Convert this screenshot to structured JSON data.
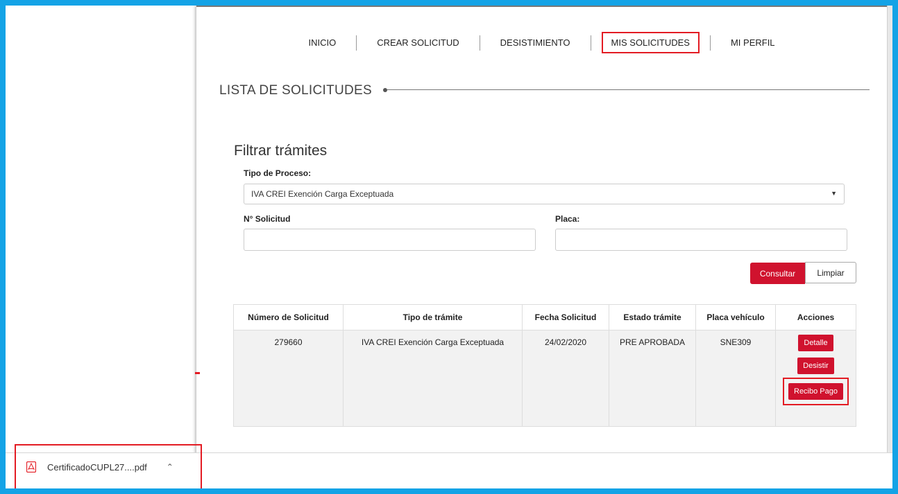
{
  "nav": {
    "items": [
      {
        "label": "INICIO"
      },
      {
        "label": "CREAR SOLICITUD"
      },
      {
        "label": "DESISTIMIENTO"
      },
      {
        "label": "MIS SOLICITUDES"
      },
      {
        "label": "MI PERFIL"
      }
    ]
  },
  "section": {
    "title": "LISTA DE SOLICITUDES"
  },
  "filter": {
    "title": "Filtrar trámites",
    "tipo_label": "Tipo de Proceso:",
    "tipo_value": "IVA CREI Exención Carga Exceptuada",
    "solicitud_label": "N° Solicitud",
    "solicitud_value": "",
    "placa_label": "Placa:",
    "placa_value": "",
    "consultar": "Consultar",
    "limpiar": "Limpiar"
  },
  "table": {
    "headers": [
      "Número de Solicitud",
      "Tipo de trámite",
      "Fecha Solicitud",
      "Estado trámite",
      "Placa vehículo",
      "Acciones"
    ],
    "rows": [
      {
        "numero": "279660",
        "tipo": "IVA CREI Exención Carga Exceptuada",
        "fecha": "24/02/2020",
        "estado": "PRE APROBADA",
        "placa": "SNE309"
      }
    ],
    "actions": {
      "detalle": "Detalle",
      "desistir": "Desistir",
      "recibo": "Recibo Pago"
    }
  },
  "download": {
    "filename": "CertificadoCUPL27....pdf"
  },
  "colors": {
    "accent": "#d0122e",
    "highlight": "#e31b23",
    "frame": "#14a3e6"
  }
}
